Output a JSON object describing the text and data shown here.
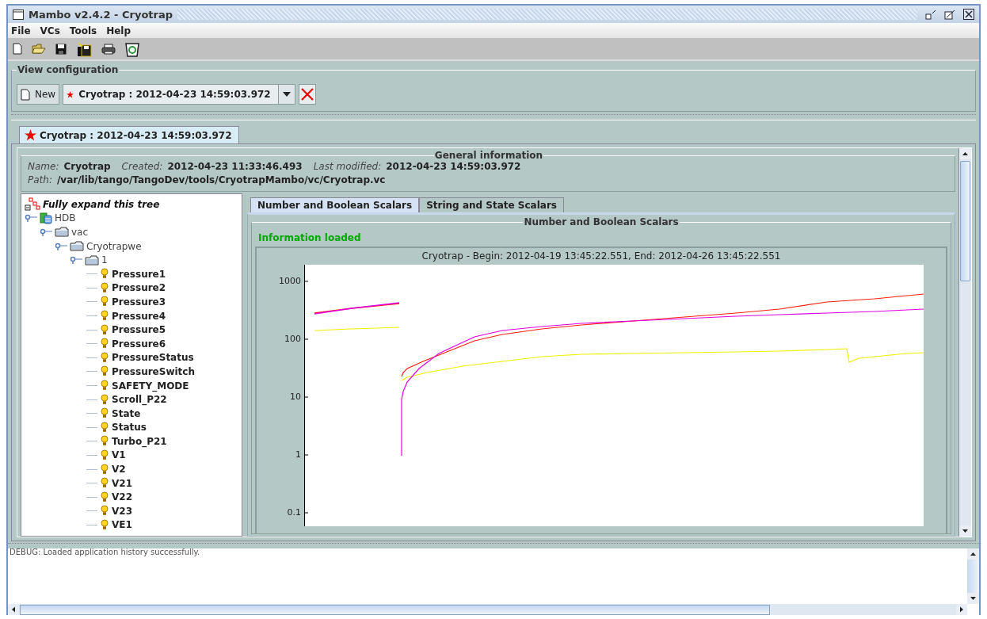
{
  "window": {
    "title": "Mambo v2.4.2 - Cryotrap"
  },
  "menu": [
    "File",
    "VCs",
    "Tools",
    "Help"
  ],
  "view_configuration": {
    "title": "View configuration",
    "new_button": "New",
    "selector_value": "Cryotrap : 2012-04-23 14:59:03.972"
  },
  "document_tab": {
    "label": "Cryotrap : 2012-04-23 14:59:03.972",
    "selected": true
  },
  "general_information": {
    "title": "General information",
    "fields": [
      {
        "label": "Name:",
        "value": "Cryotrap"
      },
      {
        "label": "Created:",
        "value": "2012-04-23 11:33:46.493"
      },
      {
        "label": "Last modified:",
        "value": "2012-04-23 14:59:03.972"
      }
    ],
    "path": {
      "label": "Path:",
      "value": "/var/lib/tango/TangoDev/tools/CryotrapMambo/vc/Cryotrap.vc"
    }
  },
  "tree": {
    "expand_link": "Fully expand this tree",
    "items": [
      {
        "label": "HDB",
        "kind": "database",
        "expanded": true,
        "children": [
          {
            "label": "vac",
            "kind": "folder",
            "expanded": true,
            "children": [
              {
                "label": "Cryotrapwe",
                "kind": "folder",
                "expanded": true,
                "children": [
                  {
                    "label": "1",
                    "kind": "folder",
                    "expanded": true,
                    "children": [
                      {
                        "label": "Pressure1",
                        "kind": "attribute"
                      },
                      {
                        "label": "Pressure2",
                        "kind": "attribute"
                      },
                      {
                        "label": "Pressure3",
                        "kind": "attribute"
                      },
                      {
                        "label": "Pressure4",
                        "kind": "attribute"
                      },
                      {
                        "label": "Pressure5",
                        "kind": "attribute"
                      },
                      {
                        "label": "Pressure6",
                        "kind": "attribute"
                      },
                      {
                        "label": "PressureStatus",
                        "kind": "attribute"
                      },
                      {
                        "label": "PressureSwitch",
                        "kind": "attribute"
                      },
                      {
                        "label": "SAFETY_MODE",
                        "kind": "attribute"
                      },
                      {
                        "label": "Scroll_P22",
                        "kind": "attribute"
                      },
                      {
                        "label": "State",
                        "kind": "attribute"
                      },
                      {
                        "label": "Status",
                        "kind": "attribute"
                      },
                      {
                        "label": "Turbo_P21",
                        "kind": "attribute"
                      },
                      {
                        "label": "V1",
                        "kind": "attribute"
                      },
                      {
                        "label": "V2",
                        "kind": "attribute"
                      },
                      {
                        "label": "V21",
                        "kind": "attribute"
                      },
                      {
                        "label": "V22",
                        "kind": "attribute"
                      },
                      {
                        "label": "V23",
                        "kind": "attribute"
                      },
                      {
                        "label": "VE1",
                        "kind": "attribute"
                      }
                    ]
                  }
                ]
              }
            ]
          }
        ]
      }
    ]
  },
  "scalar_tabs": [
    {
      "label": "Number and Boolean Scalars",
      "selected": true
    },
    {
      "label": "String and State Scalars",
      "selected": false
    }
  ],
  "scalars_panel": {
    "title": "Number and Boolean Scalars",
    "status": "Information loaded"
  },
  "chart": {
    "title": "Cryotrap - Begin: 2012-04-19 13:45:22.551, End: 2012-04-26 13:45:22.551",
    "y_tick_labels": [
      "1000",
      "100",
      "10",
      "1",
      "0.1"
    ]
  },
  "log": {
    "message": "DEBUG: Loaded application history successfully."
  }
}
